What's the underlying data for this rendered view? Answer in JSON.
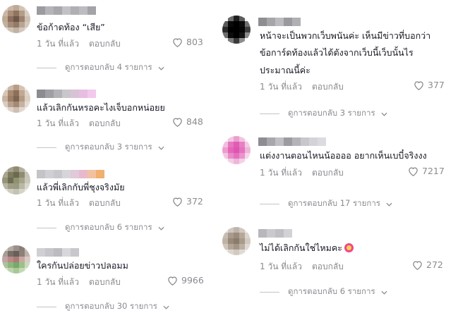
{
  "comments": [
    {
      "text": "ข้อก้าดท้อง “เสีย”",
      "time": "1 วัน ที่แล้ว",
      "reply": "ตอบกลับ",
      "likes": "803",
      "view": "ดูการตอบกลับ 4 รายการ",
      "avatar_colors": [
        "#d8cfc8",
        "#c9b7a8",
        "#bfa896",
        "#d1c3b6",
        "#e2dad2",
        "#cbb7a5",
        "#a98e78",
        "#8f7460",
        "#b39c88",
        "#d9cdc2",
        "#bea995",
        "#8c705c",
        "#6f5646",
        "#9b8270",
        "#cdbfb1",
        "#c3b19f",
        "#a48c77",
        "#927a66",
        "#b8a491",
        "#d5c9bd",
        "#e0d8d0",
        "#cfc2b5",
        "#c1b2a3",
        "#d3c8bd",
        "#e6e0da"
      ],
      "name_colors": [
        "#9c9ca0",
        "#b5b5b9",
        "#a8a8ac",
        "#c2c2c6",
        "#b0b0b4",
        "#bdbdc1",
        "#a4a4a8"
      ]
    },
    {
      "text": "แล้วเลิกกันหรอคะไงเจ็บอกหน่อยย",
      "time": "1 วัน ที่แล้ว",
      "reply": "ตอบกลับ",
      "likes": "848",
      "view": "ดูการตอบกลับ 3 รายการ",
      "avatar_colors": [
        "#e8e2dc",
        "#cdb9a8",
        "#b89c86",
        "#d4c4b5",
        "#ece8e4",
        "#d6c6b6",
        "#a98a70",
        "#8e705a",
        "#c2a892",
        "#e0d4c8",
        "#c9b29e",
        "#9c7f68",
        "#7f6452",
        "#b39a84",
        "#dccfc2",
        "#d9ccbf",
        "#b8a08a",
        "#a38a74",
        "#c6b29f",
        "#e4dbd2",
        "#efebe7",
        "#ded3c8",
        "#cdbfb1",
        "#e1d8cf",
        "#f0ece8"
      ],
      "name_colors": [
        "#8c8c90",
        "#a0a0a4",
        "#b3b3b7",
        "#c8c8cc",
        "#d9c2d6",
        "#e8bde3",
        "#f2c9ec"
      ]
    },
    {
      "text": "แล้วพี่เลิกกับพี่ชุงจริงมัย",
      "time": "1 วัน ที่แล้ว",
      "reply": "ตอบกลับ",
      "likes": "372",
      "view": "ดูการตอบกลับ 6 รายการ",
      "avatar_colors": [
        "#c8c6b8",
        "#a4a08a",
        "#8f8a70",
        "#b5b09c",
        "#dcdad0",
        "#a9a590",
        "#7d7a5f",
        "#6a6a4e",
        "#8e8c74",
        "#c6c4b5",
        "#959479",
        "#6c6e52",
        "#8f9170",
        "#a6a58a",
        "#c9c8b8",
        "#b7b6a2",
        "#9e9d84",
        "#9a9a80",
        "#b9b8a4",
        "#d8d7cb",
        "#dedcd2",
        "#cfcdc0",
        "#c4c2b3",
        "#d6d4c8",
        "#e8e6e0"
      ],
      "name_colors": [
        "#c4c4c8",
        "#d0d0d4",
        "#c8c8cc",
        "#d6d6da",
        "#e0c9d9",
        "#e8b9cc",
        "#f2c2a0",
        "#f0b070"
      ]
    },
    {
      "text": "ใครกันปล่อยข่าวปลอมม",
      "time": "1 วัน ที่แล้ว",
      "reply": "ตอบกลับ",
      "likes": "9966",
      "view": "ดูการตอบกลับ 30 รายการ",
      "avatar_colors": [
        "#cfc9c3",
        "#b3aaa2",
        "#9c9088",
        "#8a7e78",
        "#c4bcb5",
        "#a89c92",
        "#7a6e68",
        "#6a5e58",
        "#8c8078",
        "#bdb3aa",
        "#c4a3a0",
        "#b98a86",
        "#a97c76",
        "#c9a8a2",
        "#dccac4",
        "#a9c49a",
        "#8fb57e",
        "#7aa86a",
        "#9cc08a",
        "#c8dcbd",
        "#d2e2c8",
        "#bcd4ac",
        "#a8c896",
        "#c4d8b6",
        "#e0ecd8"
      ],
      "name_colors": [
        "#d0d0d4",
        "#c6c6ca",
        "#bcbcc0",
        "#d8d8dc",
        "#c8c8cc"
      ]
    },
    {
      "text_lines": [
        "หน้าจะเป็นพวกเว็บพนันค่ะ เห็นมีข่าวที่บอกว่า",
        "ข้อการ์ดท้องแล้วได้ตังจากเว็บนี้เว็บนั้นไร",
        "ประมาณนี้ค่ะ"
      ],
      "time": "1 วัน ที่แล้ว",
      "reply": "ตอบกลับ",
      "likes": "377",
      "view": "ดูการตอบกลับ 3 รายการ",
      "avatar_colors": [
        "#f4f4f4",
        "#6a6a6a",
        "#1e1e1e",
        "#5c5c5c",
        "#f0f0f0",
        "#5a5a5a",
        "#0a0a0a",
        "#000000",
        "#0c0c0c",
        "#707070",
        "#2a2a2a",
        "#000000",
        "#000000",
        "#050505",
        "#3c3c3c",
        "#6e6e6e",
        "#0c0c0c",
        "#000000",
        "#121212",
        "#8a8a8a",
        "#f2f2f2",
        "#7a7a7a",
        "#3a3a3a",
        "#8c8c8c",
        "#f6f6f6"
      ],
      "name_colors": [
        "#8e8e92",
        "#a6a6aa",
        "#bcbcc0",
        "#9a9a9e",
        "#b0b0b4"
      ]
    },
    {
      "text": "แต่งงานตอนไหนน้ออออ อยากเห็นเบบี๋จริงงง",
      "time": "1 วัน ที่แล้ว",
      "reply": "ตอบกลับ",
      "likes": "7217",
      "view": "ดูการตอบกลับ 17 รายการ",
      "avatar_colors": [
        "#f6eef4",
        "#f0c8e0",
        "#ec9ed0",
        "#f2c4de",
        "#f8f0f6",
        "#f0bfdc",
        "#e776c0",
        "#e05db4",
        "#e880c4",
        "#f4cce4",
        "#ee9cd0",
        "#e366b8",
        "#de55b0",
        "#e573bf",
        "#f0b4d8",
        "#f2c6e0",
        "#ea8ac8",
        "#e470bd",
        "#ec92cc",
        "#f6d6ea",
        "#f8f2f6",
        "#f2d0e4",
        "#eeb6d8",
        "#f3d2e6",
        "#faf5f8"
      ],
      "name_colors": [
        "#8e8e92",
        "#a8a8ac",
        "#c0c0c4",
        "#9c9ca0",
        "#b4b4b8",
        "#c8c8cc",
        "#d4d4d8",
        "#dcdce0"
      ]
    },
    {
      "text": "ไม่ได้เลิกกันใช่ไหมคะ",
      "time": "1 วัน ที่แล้ว",
      "reply": "ตอบกลับ",
      "likes": "272",
      "view": "ดูการตอบกลับ 6 รายการ",
      "avatar_colors": [
        "#e6e2de",
        "#cfc6be",
        "#c0b5aa",
        "#d2c9c0",
        "#ece9e6",
        "#c8bdb2",
        "#a89a8c",
        "#9a8b7c",
        "#b5a89a",
        "#dcd5ce",
        "#bfb3a6",
        "#988979",
        "#8a7b6b",
        "#a99b8c",
        "#d2c9c0",
        "#d0c6bc",
        "#b2a596",
        "#a49686",
        "#bcb0a3",
        "#e0dad4",
        "#ece8e4",
        "#ddd6cf",
        "#d2c9c0",
        "#e0dad4",
        "#f2efec"
      ],
      "name_colors": [
        "#b8b8bc",
        "#cacace",
        "#c0c0c4",
        "#d2d2d6"
      ]
    }
  ]
}
